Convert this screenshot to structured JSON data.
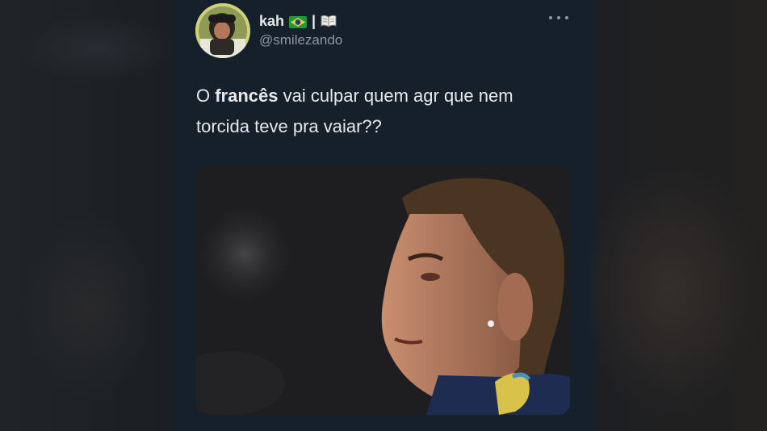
{
  "tweet": {
    "display_name": "kah",
    "separator": "|",
    "handle": "@smilezando",
    "text_part1": "O ",
    "text_bold": "francês",
    "text_part2": " vai culpar quem agr que nem torcida teve pra vaiar??",
    "emojis": [
      "brazil-flag-icon",
      "open-book-icon"
    ],
    "menu_icon": "more-options-icon"
  },
  "colors": {
    "background": "#15202b",
    "primary_text": "#e7e9ea",
    "secondary_text": "#8b98a5"
  }
}
